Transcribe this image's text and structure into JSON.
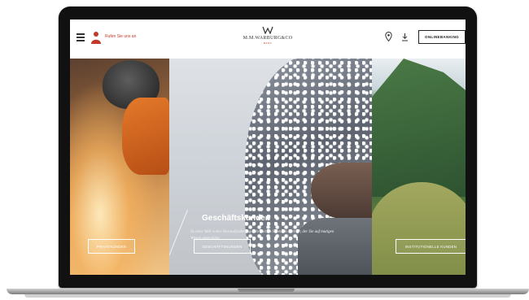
{
  "header": {
    "contact_label": "Rufen Sie uns an",
    "logo_name": "M.M.WARBURG&CO",
    "logo_sub": "BANK",
    "onlinebanking_label": "ONLINEBANKING"
  },
  "panels": {
    "geschaeft_title": "Geschäftskunden",
    "geschaeft_text": "In einer Welt voller Herausforderungen brauchen Sie einen Partner, der Sie auf mutigen Wegen unterstützt."
  },
  "ctas": {
    "privat": "PRIVATKUNDEN",
    "geschaeft": "GESCHÄFTSKUNDEN",
    "institutionell": "INSTITUTIONELLE KUNDEN"
  },
  "colors": {
    "accent": "#c0392b",
    "text_dark": "#222222"
  },
  "icons": [
    "menu-icon",
    "person-icon",
    "location-pin-icon",
    "download-icon"
  ]
}
